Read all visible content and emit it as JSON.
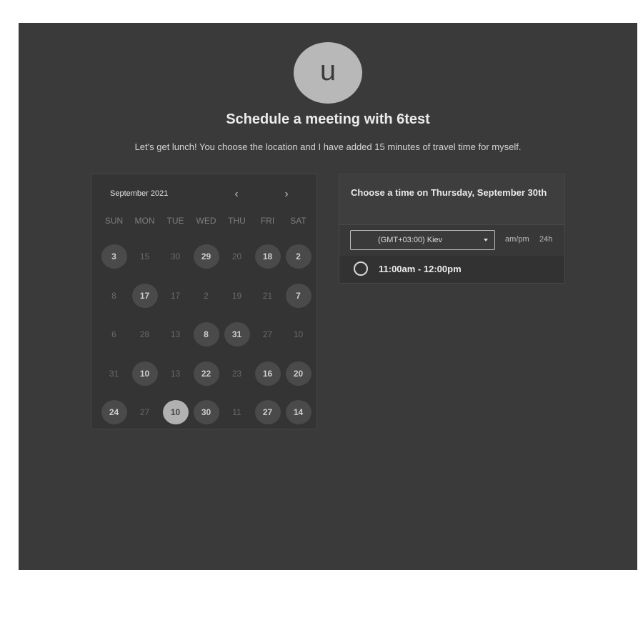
{
  "header": {
    "avatar_letter": "u",
    "title": "Schedule a meeting with 6test",
    "description": "Let's get lunch! You choose the location and I have added 15 minutes of travel time for myself."
  },
  "calendar": {
    "month_label": "September 2021",
    "prev_icon": "‹",
    "next_icon": "›",
    "weekdays": [
      "SUN",
      "MON",
      "TUE",
      "WED",
      "THU",
      "FRI",
      "SAT"
    ],
    "weeks": [
      [
        {
          "d": "3",
          "s": "avail"
        },
        {
          "d": "15",
          "s": "off"
        },
        {
          "d": "30",
          "s": "off"
        },
        {
          "d": "29",
          "s": "avail"
        },
        {
          "d": "20",
          "s": "off"
        },
        {
          "d": "18",
          "s": "avail"
        },
        {
          "d": "2",
          "s": "avail"
        }
      ],
      [
        {
          "d": "8",
          "s": "off"
        },
        {
          "d": "17",
          "s": "avail"
        },
        {
          "d": "17",
          "s": "off"
        },
        {
          "d": "2",
          "s": "off"
        },
        {
          "d": "19",
          "s": "off"
        },
        {
          "d": "21",
          "s": "off"
        },
        {
          "d": "7",
          "s": "avail"
        }
      ],
      [
        {
          "d": "6",
          "s": "off"
        },
        {
          "d": "28",
          "s": "off"
        },
        {
          "d": "13",
          "s": "off"
        },
        {
          "d": "8",
          "s": "avail"
        },
        {
          "d": "31",
          "s": "avail"
        },
        {
          "d": "27",
          "s": "off"
        },
        {
          "d": "10",
          "s": "off"
        }
      ],
      [
        {
          "d": "31",
          "s": "off"
        },
        {
          "d": "10",
          "s": "avail"
        },
        {
          "d": "13",
          "s": "off"
        },
        {
          "d": "22",
          "s": "avail"
        },
        {
          "d": "23",
          "s": "off"
        },
        {
          "d": "16",
          "s": "avail"
        },
        {
          "d": "20",
          "s": "avail"
        }
      ],
      [
        {
          "d": "24",
          "s": "avail"
        },
        {
          "d": "27",
          "s": "off"
        },
        {
          "d": "10",
          "s": "sel"
        },
        {
          "d": "30",
          "s": "avail"
        },
        {
          "d": "11",
          "s": "off"
        },
        {
          "d": "27",
          "s": "avail"
        },
        {
          "d": "14",
          "s": "avail"
        }
      ]
    ]
  },
  "times": {
    "title": "Choose a time on Thursday, September 30th",
    "timezone": "(GMT+03:00) Kiev",
    "format_ampm": "am/pm",
    "format_24h": "24h",
    "slot_label": "11:00am - 12:00pm"
  },
  "colors": {
    "panel_bg": "#3a3a3a",
    "available_day": "#4a4a4a",
    "selected_day": "#b1b1b1"
  }
}
